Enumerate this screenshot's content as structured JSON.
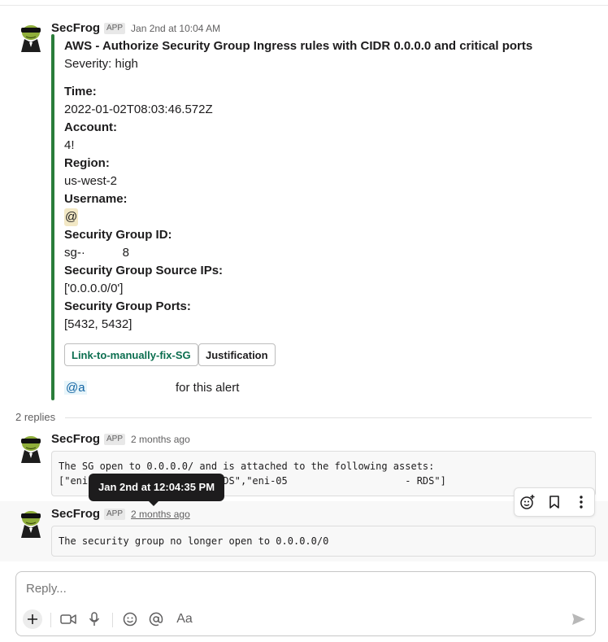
{
  "alert": {
    "sender": "SecFrog",
    "app_badge": "APP",
    "timestamp": "Jan 2nd at 10:04 AM",
    "title": "AWS - Authorize Security Group Ingress rules with CIDR 0.0.0.0 and critical ports",
    "severity": "Severity: high",
    "time_label": "Time:",
    "time_value": "2022-01-02T08:03:46.572Z",
    "account_label": "Account:",
    "account_value": "4!",
    "region_label": "Region:",
    "region_value": "us-west-2",
    "username_label": "Username:",
    "username_value": "@",
    "sg_id_label": "Security Group ID:",
    "sg_id_value": "sg-·           8",
    "sg_ips_label": "Security Group Source IPs:",
    "sg_ips_value": "['0.0.0.0/0']",
    "sg_ports_label": "Security Group Ports:",
    "sg_ports_value": "[5432, 5432]",
    "btn_fix": "Link-to-manually-fix-SG",
    "btn_justify": "Justification",
    "mention": "@a",
    "mention_suffix": "for this alert"
  },
  "thread": {
    "reply_count": "2 replies",
    "replies": [
      {
        "sender": "SecFrog",
        "app_badge": "APP",
        "timestamp": "2 months ago",
        "code": "The SG open to 0.0.0.0/ and is attached to the following assets:\n[\"eni                       DS\",\"eni-05                    - RDS\"]"
      },
      {
        "sender": "SecFrog",
        "app_badge": "APP",
        "timestamp": "2 months ago",
        "code": "The security group no longer open to 0.0.0.0/0"
      }
    ],
    "tooltip": "Jan 2nd at 12:04:35 PM"
  },
  "composer": {
    "placeholder": "Reply..."
  },
  "icons": {
    "actions": [
      "add-reaction-icon",
      "bookmark-icon",
      "more-icon"
    ],
    "toolbar": [
      "plus-icon",
      "video-icon",
      "mic-icon",
      "emoji-icon",
      "mention-icon",
      "format-icon",
      "send-icon"
    ]
  },
  "colors": {
    "attachment_bar": "#2a7d3a",
    "mention": "#1264a3",
    "green_button_text": "#0b6e4f",
    "tooltip_bg": "#1d1c1d"
  }
}
